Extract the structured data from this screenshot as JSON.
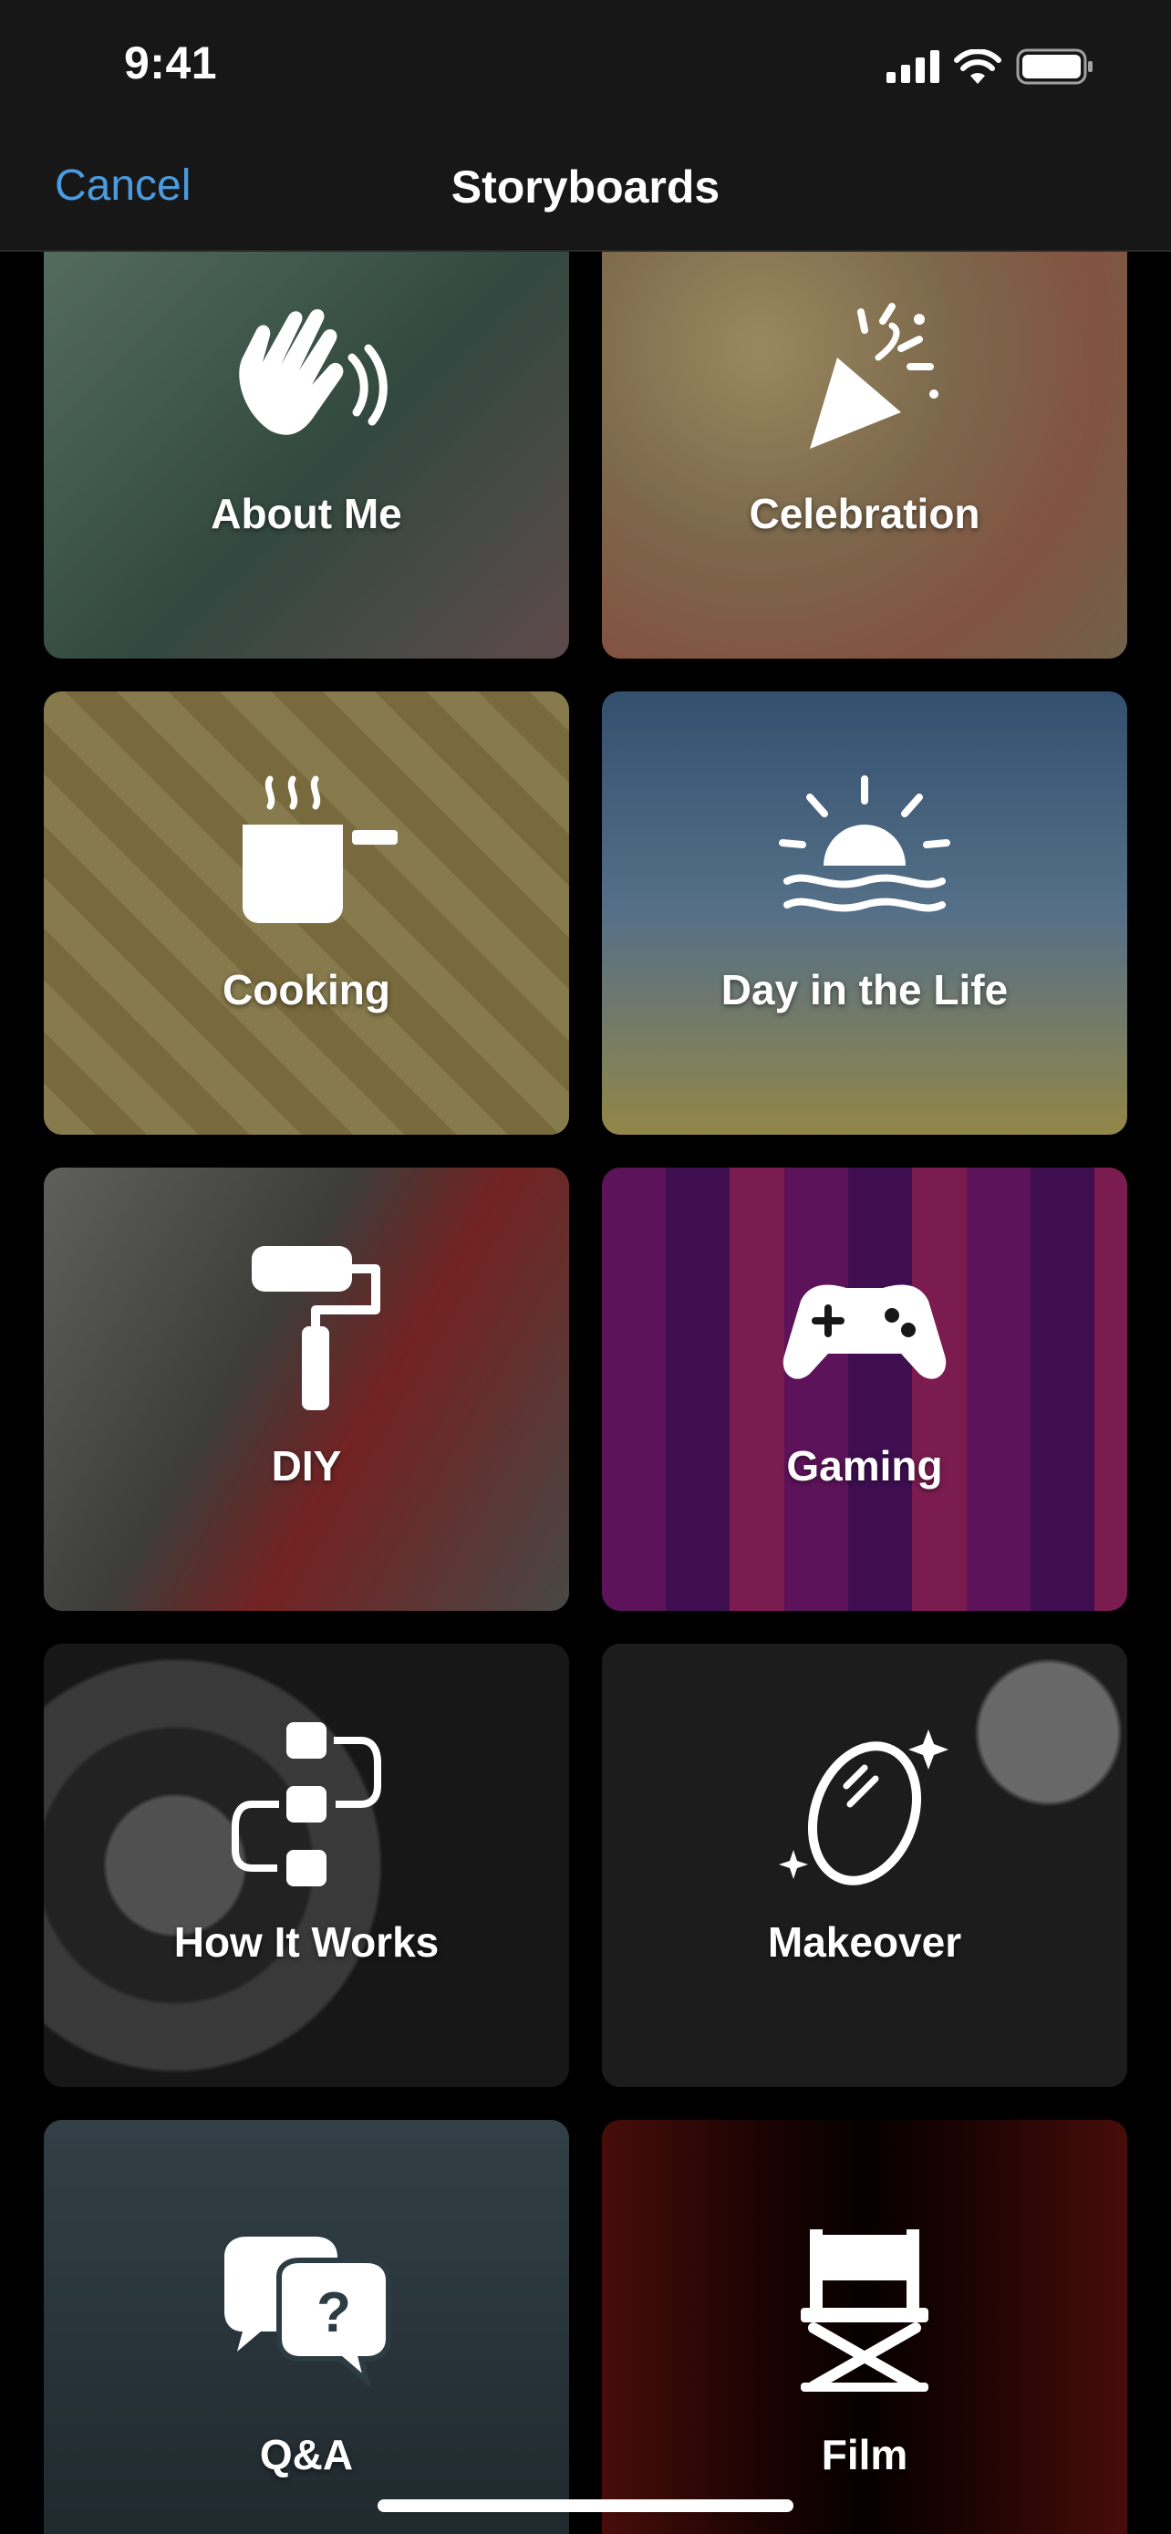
{
  "status_bar": {
    "time": "9:41"
  },
  "nav": {
    "cancel_label": "Cancel",
    "title": "Storyboards"
  },
  "tiles": [
    {
      "label": "About Me",
      "icon": "waving-hand-icon",
      "colors": [
        "#6f8f7d",
        "#3f5b52"
      ]
    },
    {
      "label": "Celebration",
      "icon": "party-popper-icon",
      "colors": [
        "#c4a97b",
        "#9a8a6a"
      ]
    },
    {
      "label": "Cooking",
      "icon": "cooking-pot-icon",
      "colors": [
        "#b9a56a",
        "#8a7a48"
      ]
    },
    {
      "label": "Day in the Life",
      "icon": "sunrise-icon",
      "colors": [
        "#5e82a8",
        "#c7b25e"
      ]
    },
    {
      "label": "DIY",
      "icon": "paint-roller-icon",
      "colors": [
        "#6c6c6a",
        "#3a3a38"
      ]
    },
    {
      "label": "Gaming",
      "icon": "game-controller-icon",
      "colors": [
        "#7a1c6e",
        "#3a1060"
      ]
    },
    {
      "label": "How It Works",
      "icon": "workflow-icon",
      "colors": [
        "#4a4a4a",
        "#202020"
      ]
    },
    {
      "label": "Makeover",
      "icon": "mirror-sparkles-icon",
      "colors": [
        "#3a3a3a",
        "#151515"
      ]
    },
    {
      "label": "Q&A",
      "icon": "question-bubbles-icon",
      "colors": [
        "#3e5058",
        "#1f2a30"
      ]
    },
    {
      "label": "Film",
      "icon": "director-chair-icon",
      "colors": [
        "#5a0f0a",
        "#1a0504"
      ]
    }
  ]
}
